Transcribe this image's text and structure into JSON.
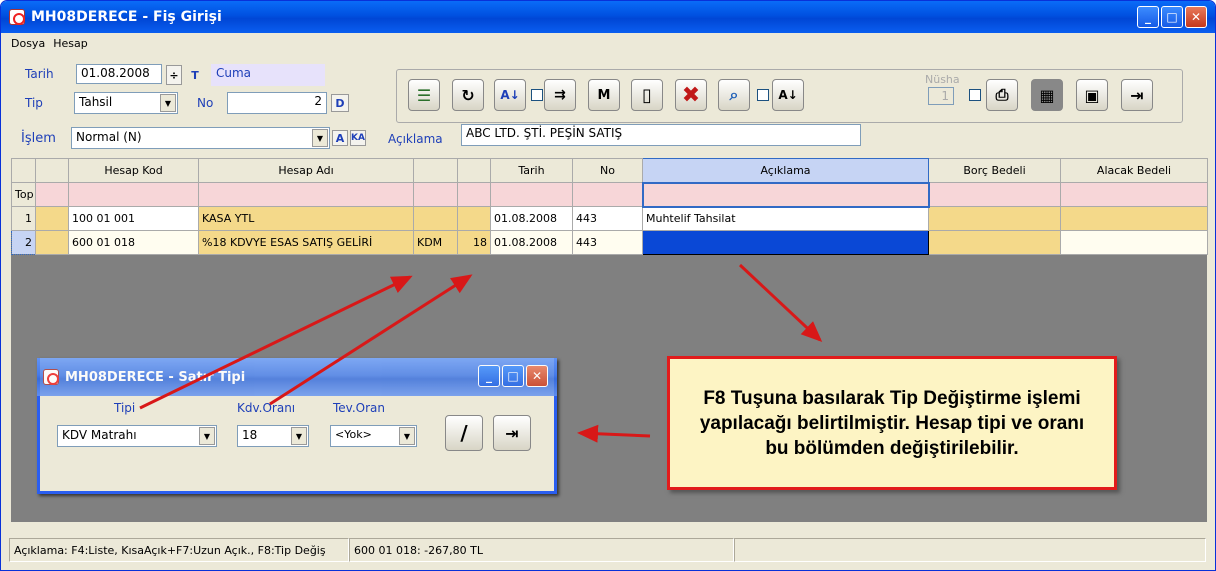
{
  "title": "MH08DERECE - Fiş Girişi",
  "menu": [
    "Dosya",
    "Hesap"
  ],
  "form": {
    "tarih_label": "Tarih",
    "tarih_value": "01.08.2008",
    "day": "Cuma",
    "tip_label": "Tip",
    "tip_value": "Tahsil",
    "no_label": "No",
    "no_value": "2",
    "d_btn": "D",
    "t_btn": "T",
    "islem_label": "İşlem",
    "islem_value": "Normal (N)",
    "aciklama_label": "Açıklama",
    "aciklama_value": "ABC LTD. ŞTİ. PEŞİN SATIŞ"
  },
  "toolbar": {
    "nusha_label": "Nüsha",
    "nusha_value": "1"
  },
  "grid": {
    "headers": [
      "",
      "",
      "Hesap Kod",
      "Hesap Adı",
      "",
      "",
      "Tarih",
      "No",
      "Açıklama",
      "Borç Bedeli",
      "Alacak Bedeli"
    ],
    "top_label": "Top",
    "rows": [
      {
        "n": "1",
        "kod": "100 01 001",
        "adi": "KASA YTL",
        "c1": "",
        "c2": "",
        "tarih": "01.08.2008",
        "no": "443",
        "acik": "Muhtelif Tahsilat"
      },
      {
        "n": "2",
        "kod": "600 01 018",
        "adi": "%18 KDVYE ESAS SATIŞ GELİRİ",
        "c1": "KDM",
        "c2": "18",
        "tarih": "01.08.2008",
        "no": "443",
        "acik": ""
      }
    ]
  },
  "dialog": {
    "title": "MH08DERECE - Satır Tipi",
    "tipi_label": "Tipi",
    "tipi_value": "KDV Matrahı",
    "kdv_label": "Kdv.Oranı",
    "kdv_value": "18",
    "tev_label": "Tev.Oran",
    "tev_value": "<Yok>"
  },
  "note": "F8 Tuşuna basılarak Tip Değiştirme işlemi yapılacağı belirtilmiştir. Hesap tipi ve oranı bu bölümden değiştirilebilir.",
  "status": {
    "help": "Açıklama: F4:Liste, KısaAçık+F7:Uzun Açık., F8:Tip Değiş",
    "info": "600 01 018: -267,80 TL"
  },
  "colors": {
    "title_blue": "#0046d5",
    "row_yellow": "#f4d98a",
    "top_pink": "#f7d6d8",
    "selected": "#0a48d6",
    "note_border": "#e21b1b",
    "arrow": "#d81818"
  }
}
